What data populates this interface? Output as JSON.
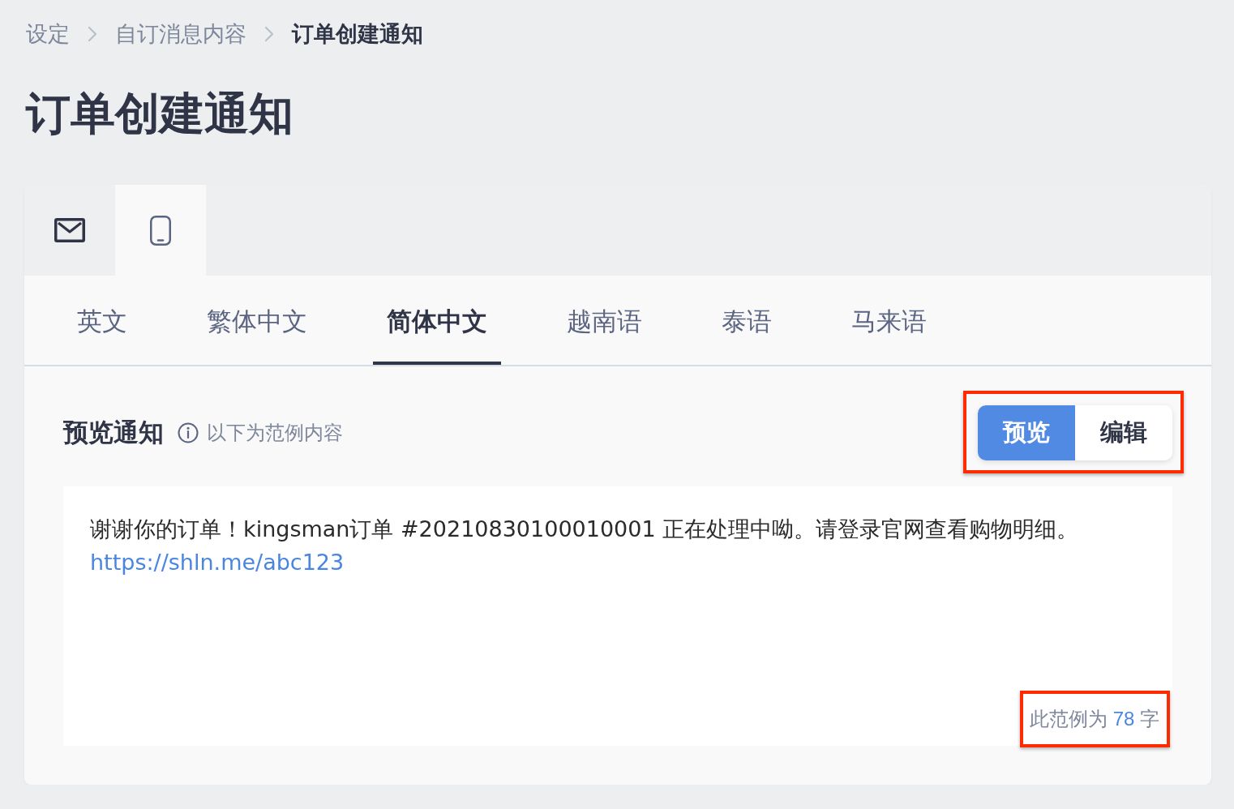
{
  "breadcrumb": [
    {
      "label": "设定",
      "current": false
    },
    {
      "label": "自订消息内容",
      "current": false
    },
    {
      "label": "订单创建通知",
      "current": true
    }
  ],
  "page_title": "订单创建通知",
  "channel_tabs": [
    {
      "kind": "email",
      "selected": false
    },
    {
      "kind": "phone",
      "selected": true
    }
  ],
  "language_tabs": [
    {
      "label": "英文",
      "selected": false
    },
    {
      "label": "繁体中文",
      "selected": false
    },
    {
      "label": "简体中文",
      "selected": true
    },
    {
      "label": "越南语",
      "selected": false
    },
    {
      "label": "泰语",
      "selected": false
    },
    {
      "label": "马来语",
      "selected": false
    }
  ],
  "preview": {
    "title": "预览通知",
    "hint": "以下为范例内容",
    "mode_toggle": {
      "highlighted": true,
      "options": [
        {
          "label": "预览",
          "selected": true
        },
        {
          "label": "编辑",
          "selected": false
        }
      ]
    },
    "message": {
      "text": "谢谢你的订单！kingsman订单 #20210830100010001 正在处理中呦。请登录官网查看购物明细。",
      "link": "https://shln.me/abc123"
    },
    "char_count": {
      "prefix": "此范例为",
      "value": "78",
      "suffix": "字",
      "highlighted": true
    }
  }
}
